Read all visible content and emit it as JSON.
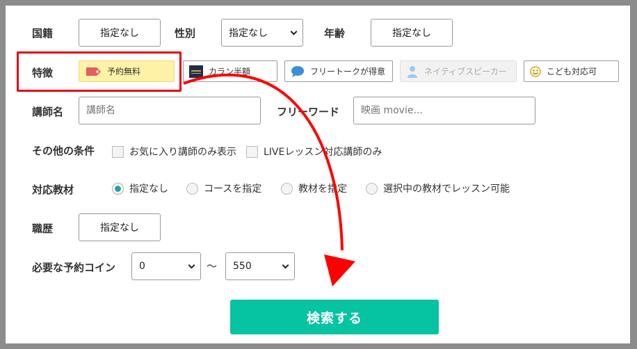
{
  "nationality": {
    "label": "国籍",
    "value": "指定なし"
  },
  "gender": {
    "label": "性別",
    "value": "指定なし"
  },
  "age": {
    "label": "年齢",
    "value": "指定なし"
  },
  "features": {
    "label": "特徴",
    "items": [
      {
        "label": "予約無料",
        "icon": "tag-icon"
      },
      {
        "label": "カラン半額",
        "icon": "callan-logo-icon"
      },
      {
        "label": "フリートークが得意",
        "icon": "speech-bubble-icon"
      },
      {
        "label": "ネイティブスピーカー",
        "icon": "person-icon"
      },
      {
        "label": "こども対応可",
        "icon": "smiley-icon"
      }
    ]
  },
  "teacher_name": {
    "label": "講師名",
    "placeholder": "講師名"
  },
  "free_word": {
    "label": "フリーワード",
    "placeholder": "映画 movie..."
  },
  "other_conditions": {
    "label": "その他の条件",
    "options": [
      "お気に入り講師のみ表示",
      "LIVEレッスン対応講師のみ"
    ]
  },
  "materials": {
    "label": "対応教材",
    "options": [
      "指定なし",
      "コースを指定",
      "教材を指定",
      "選択中の教材でレッスン可能"
    ],
    "selected": "指定なし"
  },
  "career": {
    "label": "職歴",
    "value": "指定なし"
  },
  "coins": {
    "label": "必要な予約コイン",
    "min": "0",
    "separator": "〜",
    "max": "550"
  },
  "search_button": "検索する",
  "colors": {
    "accent": "#06c3a2",
    "highlight_box": "#e60012",
    "arrow": "#ff0000",
    "selected_feature_bg": "#fdf2a6",
    "radio_selected": "#21a4a4"
  }
}
